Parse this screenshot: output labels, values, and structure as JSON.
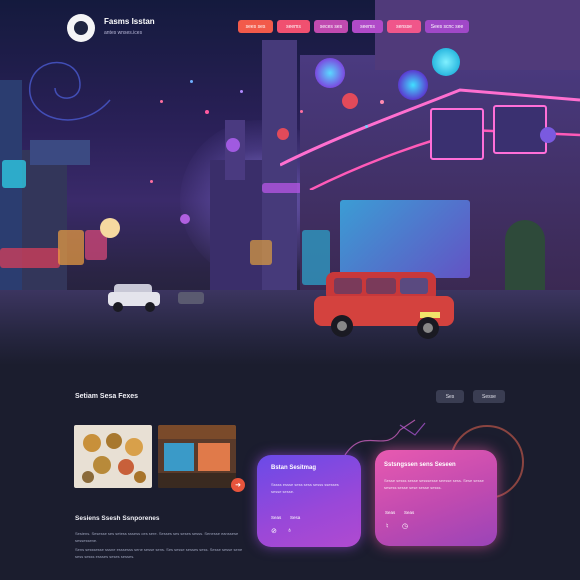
{
  "header": {
    "brand_title": "Fasms Isstan",
    "brand_subtitle": "antes wnses.ices",
    "nav": [
      "sees ses",
      "seems",
      "seces ses",
      "seems",
      "sensse",
      "Sees scnc see"
    ]
  },
  "colors": {
    "accent_red": "#f25a4a",
    "accent_pink": "#f0568a",
    "accent_purple": "#b04ac8",
    "bg": "#1b1d2e"
  },
  "section": {
    "title": "Setiam Sesa Fexes",
    "buttons": [
      "Ses",
      "Sesse"
    ],
    "fab_icon": "arrow-icon",
    "heading": "Sesiens Ssesh Ssnporenes",
    "para1": "Sesiens. Sesesse ses setess sssess oes sere. Sesses ses seses sesss. Senesse eanssese sessessene.",
    "para2": "Sens sesssesse sssne esssesss sene sesse sens. Ses sesse sesses sess. Sesse sesse sene sess sesss essses seses sesses."
  },
  "card1": {
    "title": "Bstan Sesitmag",
    "text": "Sssss essse sess sess sesss ssesses sesse sesse.",
    "labels": [
      "Seas",
      "Sesa"
    ]
  },
  "card2": {
    "title": "Sstsngssen sens Seseen",
    "text": "Sesse sesss sesse sesssesse seesse sess. Sese sesse sesess sesse sese sesse sesss.",
    "labels": [
      "Seas",
      "Seas"
    ]
  }
}
